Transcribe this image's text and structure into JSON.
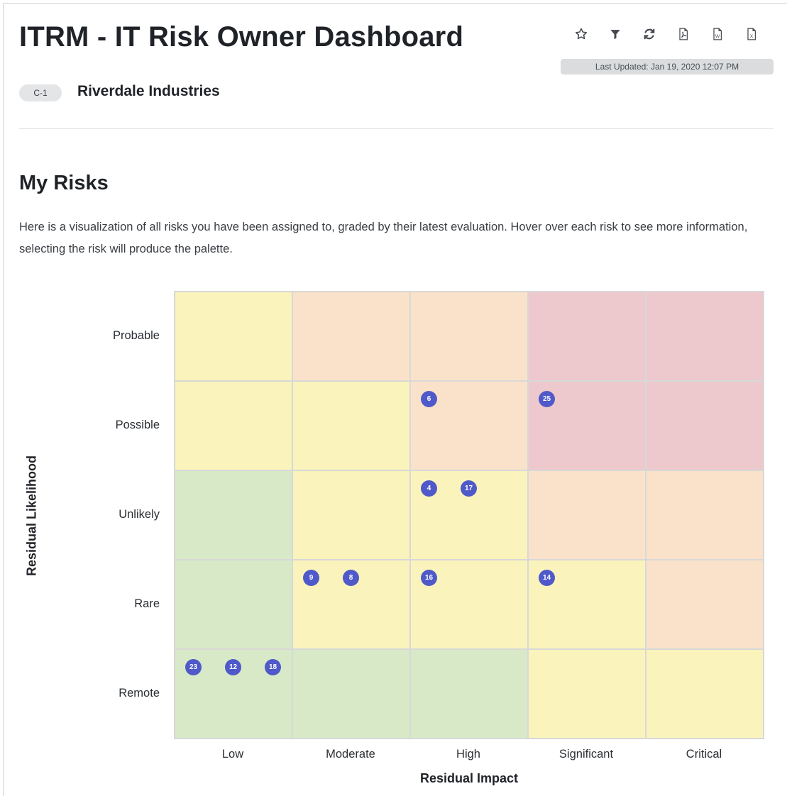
{
  "header": {
    "title": "ITRM - IT Risk Owner Dashboard",
    "last_updated": "Last Updated: Jan 19, 2020 12:07 PM",
    "toolbar": [
      {
        "name": "star-icon",
        "label": "Favorite"
      },
      {
        "name": "filter-icon",
        "label": "Filter"
      },
      {
        "name": "refresh-icon",
        "label": "Refresh"
      },
      {
        "name": "pdf-export-icon",
        "label": "Export PDF"
      },
      {
        "name": "word-export-icon",
        "label": "Export Word"
      },
      {
        "name": "excel-export-icon",
        "label": "Export Excel"
      }
    ]
  },
  "org": {
    "code": "C-1",
    "name": "Riverdale Industries"
  },
  "section": {
    "title": "My Risks",
    "description": "Here is a visualization of all risks you have been assigned to, graded by their latest evaluation. Hover over each risk to see more information, selecting the risk will produce the palette."
  },
  "heatmap": {
    "x_title": "Residual Impact",
    "y_title": "Residual Likelihood",
    "columns": [
      "Low",
      "Moderate",
      "High",
      "Significant",
      "Critical"
    ],
    "rows": [
      "Probable",
      "Possible",
      "Unlikely",
      "Rare",
      "Remote"
    ],
    "colors": {
      "green": "#d7e9c6",
      "yellow": "#faf3bb",
      "orange": "#fae2ca",
      "red": "#edc9cd",
      "marker": "#4f59c9"
    },
    "cell_levels": [
      [
        "yellow",
        "orange",
        "orange",
        "red",
        "red"
      ],
      [
        "yellow",
        "yellow",
        "orange",
        "red",
        "red"
      ],
      [
        "green",
        "yellow",
        "yellow",
        "orange",
        "orange"
      ],
      [
        "green",
        "yellow",
        "yellow",
        "yellow",
        "orange"
      ],
      [
        "green",
        "green",
        "green",
        "yellow",
        "yellow"
      ]
    ],
    "risks": [
      {
        "id": "6",
        "likelihood": "Possible",
        "impact": "High"
      },
      {
        "id": "25",
        "likelihood": "Possible",
        "impact": "Significant"
      },
      {
        "id": "4",
        "likelihood": "Unlikely",
        "impact": "High"
      },
      {
        "id": "17",
        "likelihood": "Unlikely",
        "impact": "High"
      },
      {
        "id": "9",
        "likelihood": "Rare",
        "impact": "Moderate"
      },
      {
        "id": "8",
        "likelihood": "Rare",
        "impact": "Moderate"
      },
      {
        "id": "16",
        "likelihood": "Rare",
        "impact": "High"
      },
      {
        "id": "14",
        "likelihood": "Rare",
        "impact": "Significant"
      },
      {
        "id": "23",
        "likelihood": "Remote",
        "impact": "Low"
      },
      {
        "id": "12",
        "likelihood": "Remote",
        "impact": "Low"
      },
      {
        "id": "18",
        "likelihood": "Remote",
        "impact": "Low"
      }
    ]
  }
}
